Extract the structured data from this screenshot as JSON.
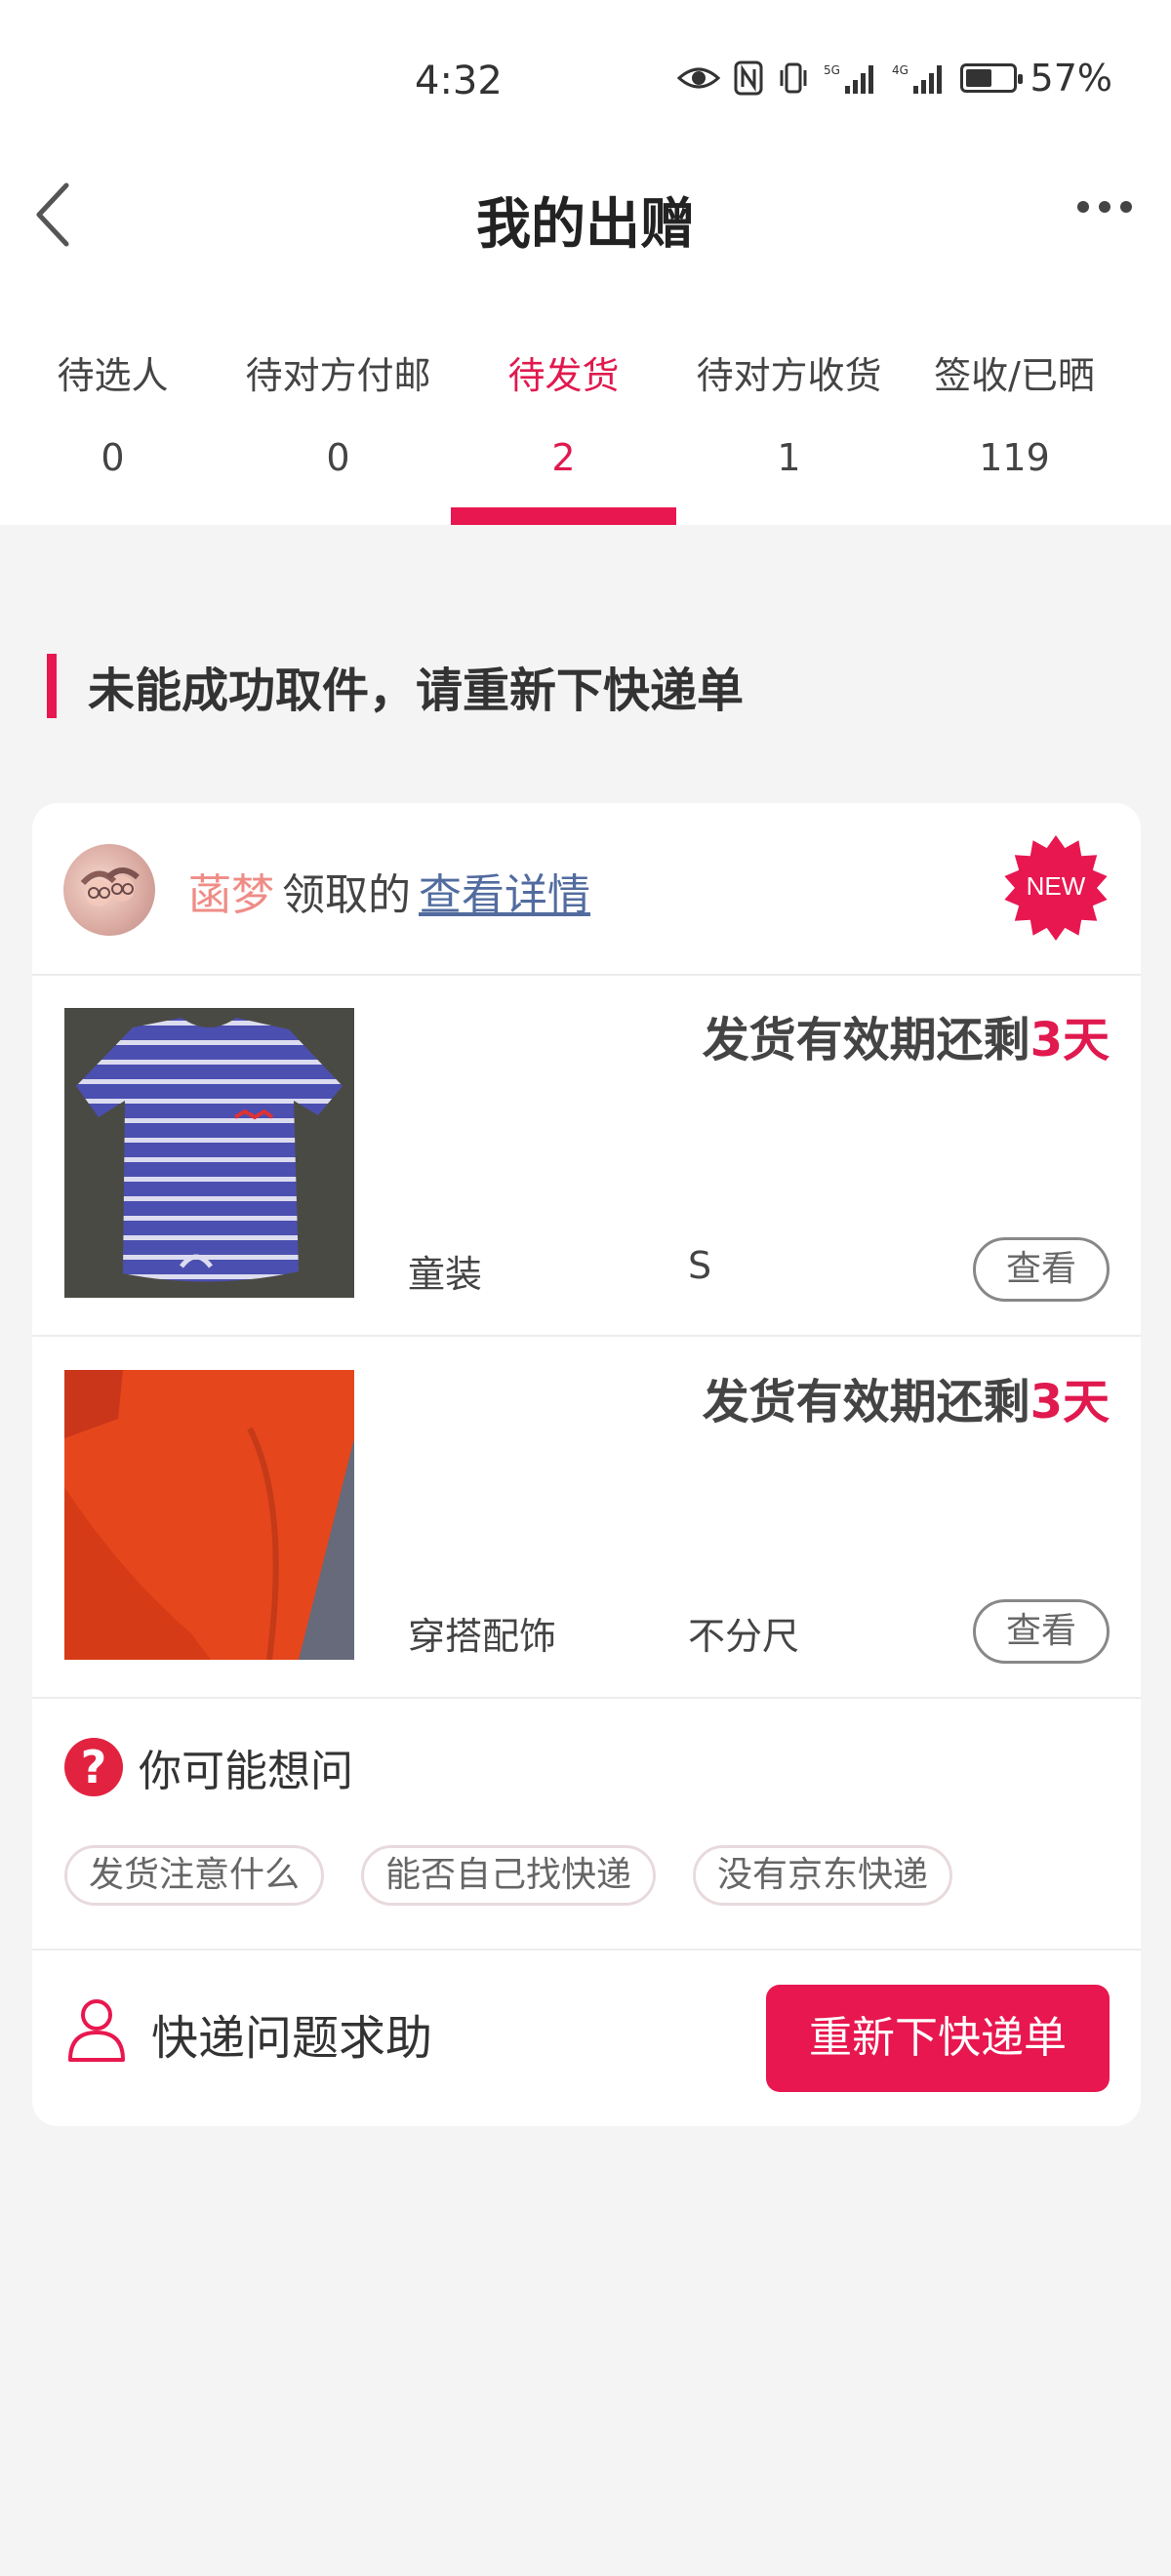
{
  "status_bar": {
    "time": "4:32",
    "battery_percent": "57%",
    "battery_level": 0.57
  },
  "nav": {
    "title": "我的出赠"
  },
  "tabs": [
    {
      "label": "待选人",
      "count": "0"
    },
    {
      "label": "待对方付邮",
      "count": "0"
    },
    {
      "label": "待发货",
      "count": "2"
    },
    {
      "label": "待对方收货",
      "count": "1"
    },
    {
      "label": "签收/已晒",
      "count": "119"
    }
  ],
  "active_tab": 2,
  "section": {
    "heading": "未能成功取件，请重新下快递单"
  },
  "receiver": {
    "name": "菡梦",
    "action": "领取的",
    "link": "查看详情",
    "badge": "NEW"
  },
  "items": [
    {
      "deadline_prefix": "发货有效期还剩",
      "deadline_days": "3天",
      "category": "童装",
      "size": "S",
      "button": "查看"
    },
    {
      "deadline_prefix": "发货有效期还剩",
      "deadline_days": "3天",
      "category": "穿搭配饰",
      "size": "不分尺",
      "button": "查看"
    }
  ],
  "faq": {
    "title": "你可能想问",
    "chips": [
      "发货注意什么",
      "能否自己找快递",
      "没有京东快递"
    ]
  },
  "help": {
    "label": "快递问题求助",
    "button": "重新下快递单"
  },
  "colors": {
    "accent": "#e8174f",
    "receiver_name": "#ef8c86",
    "link": "#526c9f"
  }
}
